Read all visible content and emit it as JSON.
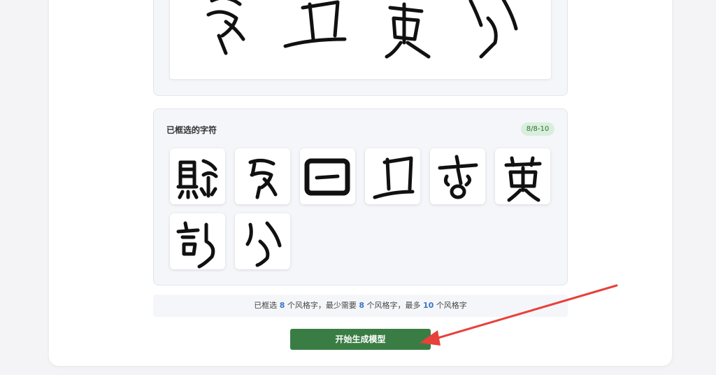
{
  "selected": {
    "title": "已框选的字符",
    "badge": "8/8-10",
    "glyph_icons": [
      "seal-glyph-1",
      "seal-glyph-2",
      "seal-glyph-3",
      "seal-glyph-4",
      "seal-glyph-5",
      "seal-glyph-6",
      "seal-glyph-7",
      "seal-glyph-8"
    ]
  },
  "info": {
    "prefix": "已框选",
    "selected_count": "8",
    "mid1": "个风格字，最少需要",
    "min_count": "8",
    "mid2": "个风格字，最多",
    "max_count": "10",
    "suffix": "个风格字"
  },
  "actions": {
    "start_label": "开始生成模型"
  },
  "colors": {
    "primary_button": "#3a7d44",
    "badge_bg": "#d8efdc",
    "number_accent": "#3a76c4",
    "annotation_arrow": "#e8403a"
  }
}
